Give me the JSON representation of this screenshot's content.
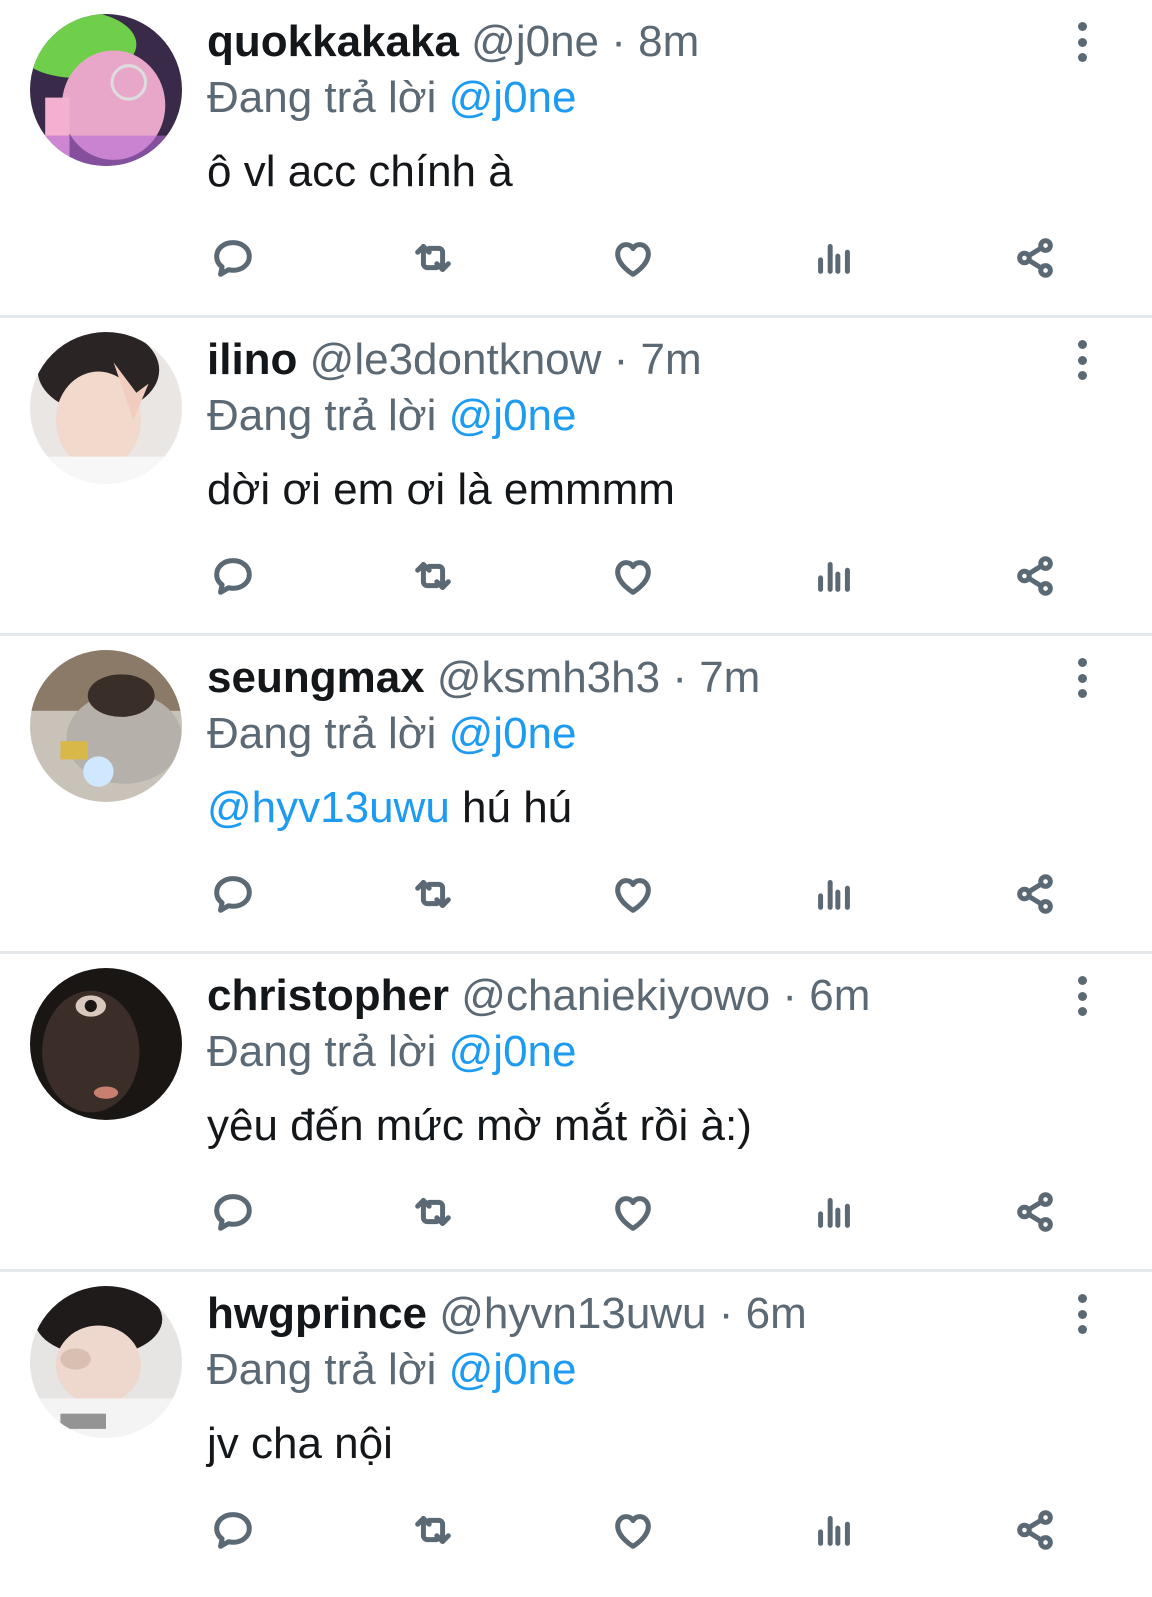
{
  "colors": {
    "accent": "#1d9bf0",
    "secondary_text": "#5b6975",
    "divider": "#e6e9ec"
  },
  "tweets": [
    {
      "display_name": "quokkakaka",
      "handle": "@j0ne",
      "time": "8m",
      "reply_prefix": "Đang trả lời",
      "reply_to": "@j0ne",
      "text_mention": "",
      "text": "ô vl acc chính à",
      "avatar_icon": "avatar-photo"
    },
    {
      "display_name": "ilino",
      "handle": "@le3dontknow",
      "time": "7m",
      "reply_prefix": "Đang trả lời",
      "reply_to": "@j0ne",
      "text_mention": "",
      "text": "dời ơi em ơi là emmmm",
      "avatar_icon": "avatar-photo"
    },
    {
      "display_name": "seungmax",
      "handle": "@ksmh3h3",
      "time": "7m",
      "reply_prefix": "Đang trả lời",
      "reply_to": "@j0ne",
      "text_mention": "@hyv13uwu",
      "text": "hú hú",
      "avatar_icon": "avatar-photo"
    },
    {
      "display_name": "christopher",
      "handle": "@chaniekiyowo",
      "time": "6m",
      "reply_prefix": "Đang trả lời",
      "reply_to": "@j0ne",
      "text_mention": "",
      "text": "yêu đến mức mờ mắt rồi à:)",
      "avatar_icon": "avatar-photo"
    },
    {
      "display_name": "hwgprince",
      "handle": "@hyvn13uwu",
      "time": "6m",
      "reply_prefix": "Đang trả lời",
      "reply_to": "@j0ne",
      "text_mention": "",
      "text": "jv cha nội",
      "avatar_icon": "avatar-photo"
    }
  ],
  "action_icons": [
    "reply-icon",
    "retweet-icon",
    "like-icon",
    "stats-icon",
    "share-icon"
  ],
  "separator": "·"
}
